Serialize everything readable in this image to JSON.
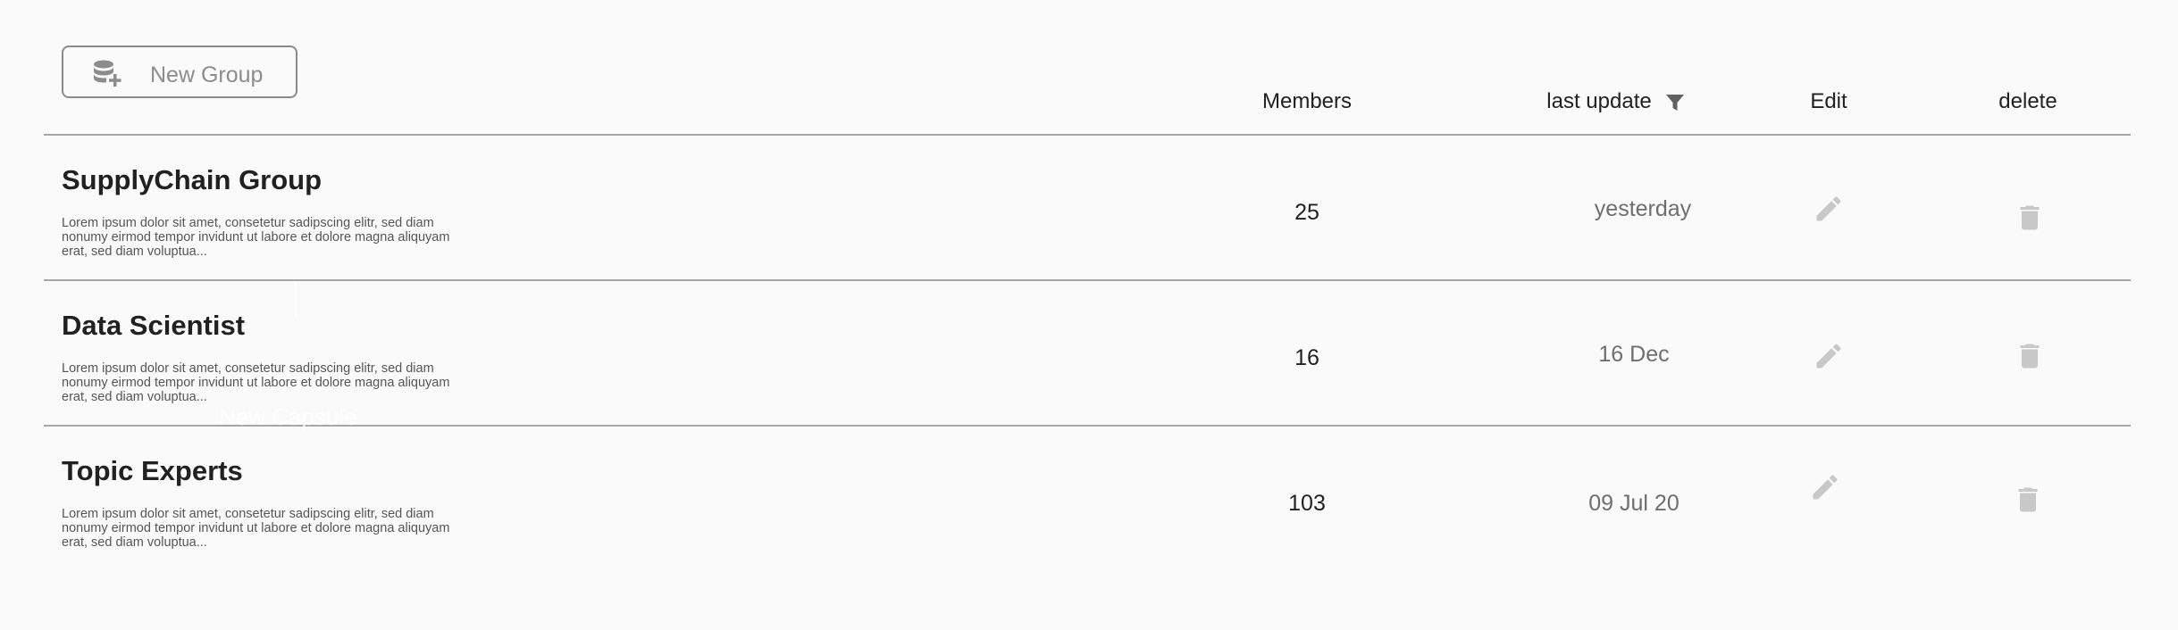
{
  "toolbar": {
    "new_group_label": "New Group",
    "new_group_icon": "database-add-icon"
  },
  "table": {
    "headers": {
      "members": "Members",
      "last_update": "last update",
      "edit": "Edit",
      "delete": "delete"
    },
    "filter_icon": "filter-icon",
    "rows": [
      {
        "title": "SupplyChain Group",
        "description": "Lorem ipsum dolor sit amet, consetetur sadipscing elitr, sed diam nonumy eirmod tempor invidunt ut labore et dolore magna aliquyam erat, sed diam voluptua...",
        "members": "25",
        "last_update": "yesterday"
      },
      {
        "title": "Data Scientist",
        "description": "Lorem ipsum dolor sit amet, consetetur sadipscing elitr, sed diam nonumy eirmod tempor invidunt ut labore et dolore magna aliquyam erat, sed diam voluptua...",
        "members": "16",
        "last_update": "16 Dec"
      },
      {
        "title": "Topic Experts",
        "description": "Lorem ipsum dolor sit amet, consetetur sadipscing elitr, sed diam nonumy eirmod tempor invidunt ut labore et dolore magna aliquyam erat, sed diam voluptua...",
        "members": "103",
        "last_update": "09 Jul 20"
      }
    ]
  },
  "ghost_overlay": {
    "text": "New Capsule"
  },
  "colors": {
    "background": "#fafafa",
    "divider": "#a6a6a6",
    "icon_gray": "#c8c8c8",
    "button_border": "#8a8a8a",
    "text_dark": "#212121",
    "text_muted": "#6e6e6e"
  }
}
